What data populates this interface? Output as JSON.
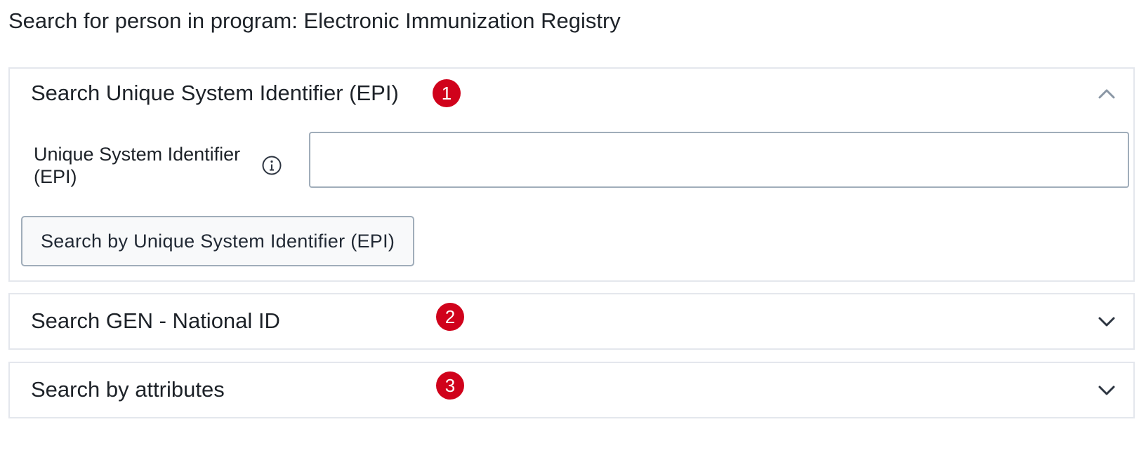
{
  "page": {
    "title": "Search for person in program: Electronic Immunization Registry"
  },
  "colors": {
    "badge": "#d0021b",
    "border": "#e4e7ed",
    "text": "#1d2228",
    "input_border": "#a0adba"
  },
  "sections": [
    {
      "title": "Search Unique System Identifier (EPI)",
      "badge": "1",
      "expanded": true,
      "chevron_icon": "chevron-up-icon",
      "field": {
        "label": "Unique System Identifier (EPI)",
        "value": "",
        "placeholder": "",
        "info_icon": "info-icon"
      },
      "button_label": "Search by Unique System Identifier (EPI)"
    },
    {
      "title": "Search GEN - National ID",
      "badge": "2",
      "expanded": false,
      "chevron_icon": "chevron-down-icon"
    },
    {
      "title": "Search by attributes",
      "badge": "3",
      "expanded": false,
      "chevron_icon": "chevron-down-icon"
    }
  ]
}
